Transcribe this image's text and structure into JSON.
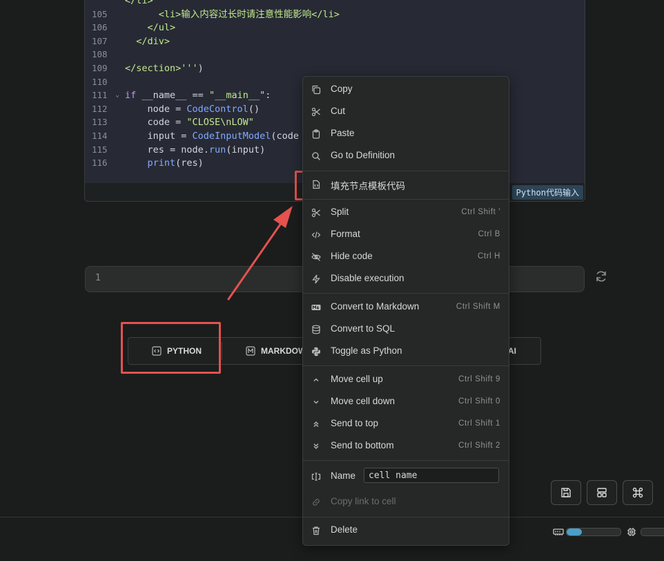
{
  "code_cell": {
    "lines": [
      {
        "ln": "",
        "fold": "",
        "parts": [
          {
            "t": "</li>",
            "c": "tag"
          }
        ]
      },
      {
        "ln": "105",
        "fold": "",
        "parts": [
          {
            "t": "      <li>输入内容过长时请注意性能影响</li>",
            "c": "tag"
          }
        ]
      },
      {
        "ln": "106",
        "fold": "",
        "parts": [
          {
            "t": "    </ul>",
            "c": "tag"
          }
        ]
      },
      {
        "ln": "107",
        "fold": "",
        "parts": [
          {
            "t": "  </div>",
            "c": "tag"
          }
        ]
      },
      {
        "ln": "108",
        "fold": "",
        "parts": []
      },
      {
        "ln": "109",
        "fold": "",
        "parts": [
          {
            "t": "</section>'''",
            "c": "tag"
          },
          {
            "t": ")",
            "c": ""
          }
        ]
      },
      {
        "ln": "110",
        "fold": "",
        "parts": []
      },
      {
        "ln": "111",
        "fold": "⌄",
        "parts": [
          {
            "t": "if",
            "c": "kw"
          },
          {
            "t": " __name__ == ",
            "c": ""
          },
          {
            "t": "\"__main__\"",
            "c": "str"
          },
          {
            "t": ":",
            "c": ""
          }
        ]
      },
      {
        "ln": "112",
        "fold": "",
        "parts": [
          {
            "t": "    node = ",
            "c": ""
          },
          {
            "t": "CodeControl",
            "c": "fn"
          },
          {
            "t": "()",
            "c": ""
          }
        ]
      },
      {
        "ln": "113",
        "fold": "",
        "parts": [
          {
            "t": "    code = ",
            "c": ""
          },
          {
            "t": "\"CLOSE\\nLOW\"",
            "c": "str"
          }
        ]
      },
      {
        "ln": "114",
        "fold": "",
        "parts": [
          {
            "t": "    input = ",
            "c": ""
          },
          {
            "t": "CodeInputModel",
            "c": "fn"
          },
          {
            "t": "(code",
            "c": ""
          }
        ]
      },
      {
        "ln": "115",
        "fold": "",
        "parts": [
          {
            "t": "    res = node.",
            "c": ""
          },
          {
            "t": "run",
            "c": "fn"
          },
          {
            "t": "(input)",
            "c": ""
          }
        ]
      },
      {
        "ln": "116",
        "fold": "",
        "parts": [
          {
            "t": "    ",
            "c": ""
          },
          {
            "t": "print",
            "c": "fn"
          },
          {
            "t": "(res)",
            "c": ""
          }
        ]
      }
    ],
    "language_tag": "Python代码输入"
  },
  "input_cell": {
    "line_number": "1"
  },
  "add_bar": {
    "python_label": "PYTHON",
    "markdown_label": "MARKDOW",
    "ai_label": "AI"
  },
  "context_menu": {
    "copy": "Copy",
    "cut": "Cut",
    "paste": "Paste",
    "go_to_definition": "Go to Definition",
    "fill_template": "填充节点模板代码",
    "split": "Split",
    "split_sc": "Ctrl Shift '",
    "format": "Format",
    "format_sc": "Ctrl B",
    "hide_code": "Hide code",
    "hide_code_sc": "Ctrl H",
    "disable_execution": "Disable execution",
    "convert_markdown": "Convert to Markdown",
    "convert_markdown_sc": "Ctrl Shift M",
    "convert_sql": "Convert to SQL",
    "toggle_python": "Toggle as Python",
    "move_up": "Move cell up",
    "move_up_sc": "Ctrl Shift 9",
    "move_down": "Move cell down",
    "move_down_sc": "Ctrl Shift 0",
    "send_top": "Send to top",
    "send_top_sc": "Ctrl Shift 1",
    "send_bottom": "Send to bottom",
    "send_bottom_sc": "Ctrl Shift 2",
    "name_label": "Name",
    "name_value": "cell name",
    "copy_link": "Copy link to cell",
    "delete": "Delete"
  },
  "status": {
    "memory_fraction": 0.28,
    "cpu_fraction": 0
  },
  "colors": {
    "highlight": "#e5524f",
    "accent": "#4a9fc9"
  }
}
